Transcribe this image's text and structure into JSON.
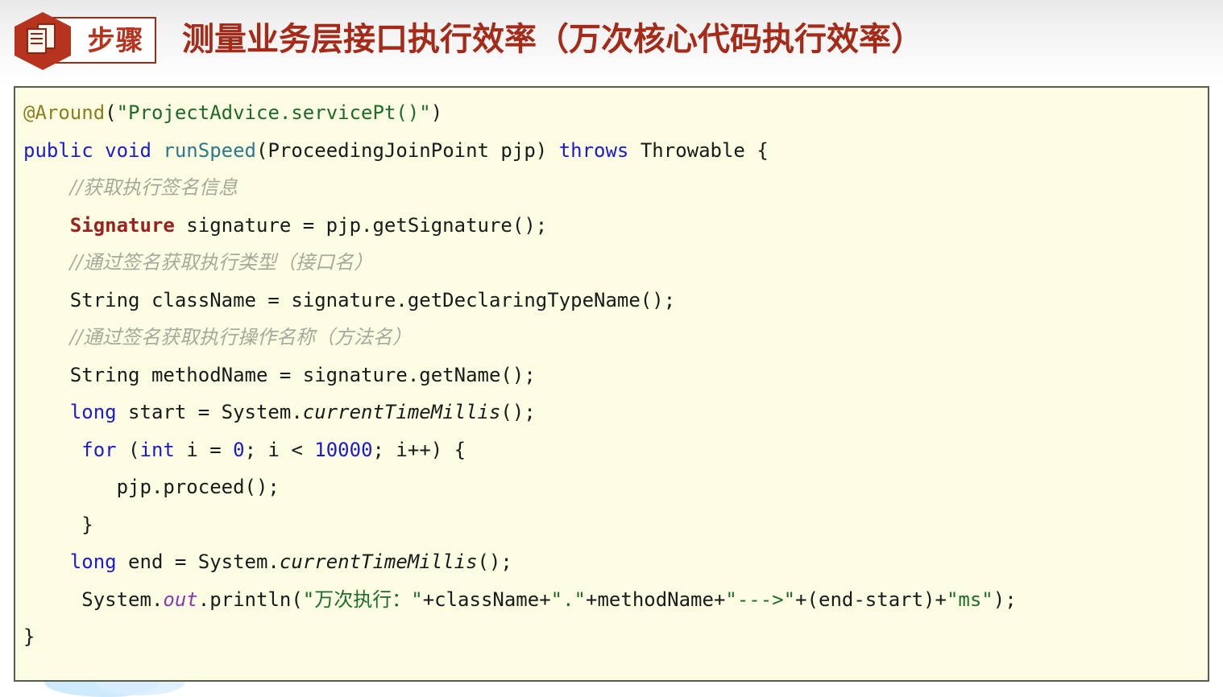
{
  "header": {
    "badge_label": "步骤",
    "badge_icon": "document-pages-icon",
    "title": "测量业务层接口执行效率（万次核心代码执行效率）",
    "accent_color": "#a52a18",
    "badge_hex_color": "#b6331d"
  },
  "code_panel": {
    "background_color": "#fdfde3",
    "border_color": "#5c5c4c",
    "language": "java",
    "lines": [
      {
        "indent": 0,
        "tokens": [
          {
            "text": "@Around",
            "type": "ann"
          },
          {
            "text": "(",
            "type": "plain"
          },
          {
            "text": "\"ProjectAdvice.servicePt()\"",
            "type": "str"
          },
          {
            "text": ")",
            "type": "plain"
          }
        ]
      },
      {
        "indent": 0,
        "tokens": [
          {
            "text": "public",
            "type": "kw"
          },
          {
            "text": " ",
            "type": "plain"
          },
          {
            "text": "void",
            "type": "kw"
          },
          {
            "text": " ",
            "type": "plain"
          },
          {
            "text": "runSpeed",
            "type": "fn"
          },
          {
            "text": "(ProceedingJoinPoint pjp) ",
            "type": "plain"
          },
          {
            "text": "throws",
            "type": "kw"
          },
          {
            "text": " Throwable {",
            "type": "plain"
          }
        ]
      },
      {
        "indent": 2,
        "tokens": [
          {
            "text": "//获取执行签名信息",
            "type": "cmt"
          }
        ]
      },
      {
        "indent": 2,
        "tokens": [
          {
            "text": "Signature",
            "type": "type"
          },
          {
            "text": " signature = pjp.getSignature();",
            "type": "plain"
          }
        ]
      },
      {
        "indent": 2,
        "tokens": [
          {
            "text": "//通过签名获取执行类型（接口名）",
            "type": "cmt"
          }
        ]
      },
      {
        "indent": 2,
        "tokens": [
          {
            "text": "String className = signature.getDeclaringTypeName();",
            "type": "plain"
          }
        ]
      },
      {
        "indent": 2,
        "tokens": [
          {
            "text": "//通过签名获取执行操作名称（方法名）",
            "type": "cmt"
          }
        ]
      },
      {
        "indent": 2,
        "tokens": [
          {
            "text": "String methodName = signature.getName();",
            "type": "plain"
          }
        ]
      },
      {
        "indent": 2,
        "tokens": [
          {
            "text": "long",
            "type": "kw"
          },
          {
            "text": " start = System.",
            "type": "plain"
          },
          {
            "text": "currentTimeMillis",
            "type": "static"
          },
          {
            "text": "();",
            "type": "plain"
          }
        ]
      },
      {
        "indent": 2,
        "tokens": [
          {
            "text": " ",
            "type": "plain"
          },
          {
            "text": "for",
            "type": "kw"
          },
          {
            "text": " (",
            "type": "plain"
          },
          {
            "text": "int",
            "type": "kw"
          },
          {
            "text": " i = ",
            "type": "plain"
          },
          {
            "text": "0",
            "type": "num"
          },
          {
            "text": "; i < ",
            "type": "plain"
          },
          {
            "text": "10000",
            "type": "num"
          },
          {
            "text": "; i++) {",
            "type": "plain"
          }
        ]
      },
      {
        "indent": 4,
        "tokens": [
          {
            "text": "pjp.proceed();",
            "type": "plain"
          }
        ]
      },
      {
        "indent": 2,
        "tokens": [
          {
            "text": " }",
            "type": "plain"
          }
        ]
      },
      {
        "indent": 2,
        "tokens": [
          {
            "text": "long",
            "type": "kw"
          },
          {
            "text": " end = System.",
            "type": "plain"
          },
          {
            "text": "currentTimeMillis",
            "type": "static"
          },
          {
            "text": "();",
            "type": "plain"
          }
        ]
      },
      {
        "indent": 2,
        "tokens": [
          {
            "text": " System.",
            "type": "plain"
          },
          {
            "text": "out",
            "type": "field"
          },
          {
            "text": ".println(",
            "type": "plain"
          },
          {
            "text": "\"万次执行：\"",
            "type": "str"
          },
          {
            "text": "+className+",
            "type": "plain"
          },
          {
            "text": "\".\"",
            "type": "str"
          },
          {
            "text": "+methodName+",
            "type": "plain"
          },
          {
            "text": "\"--->\"",
            "type": "str"
          },
          {
            "text": "+(end-start)+",
            "type": "plain"
          },
          {
            "text": "\"ms\"",
            "type": "str"
          },
          {
            "text": ");",
            "type": "plain"
          }
        ]
      },
      {
        "indent": 0,
        "tokens": [
          {
            "text": "}",
            "type": "plain"
          }
        ]
      }
    ]
  }
}
